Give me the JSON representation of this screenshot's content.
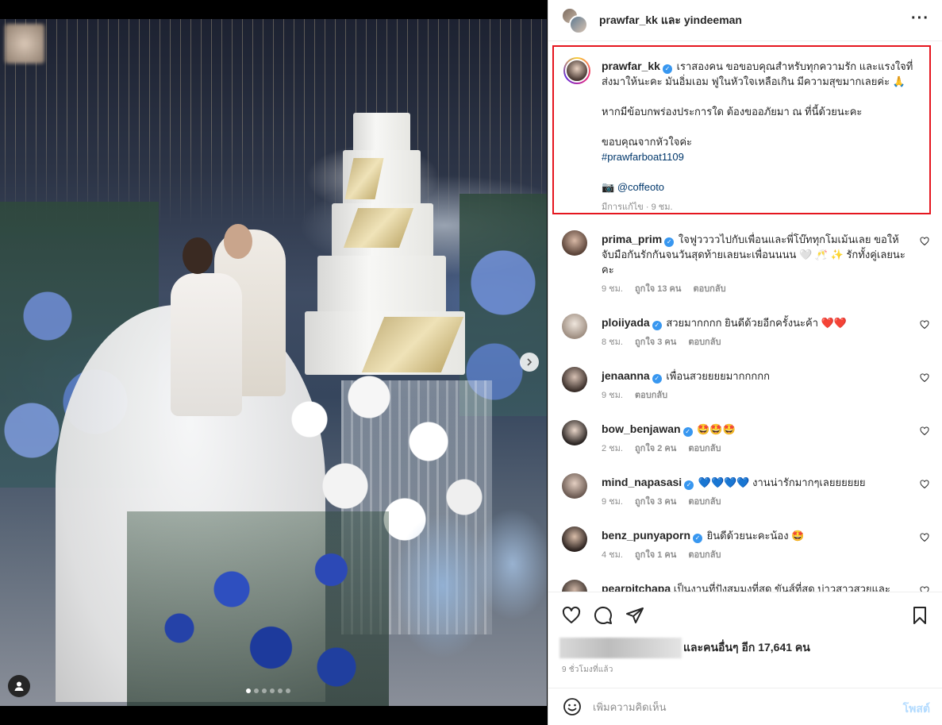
{
  "post": {
    "header": {
      "title_user1": "prawfar_kk",
      "title_and": "และ",
      "title_user2": "yindeeman"
    },
    "caption": {
      "username": "prawfar_kk",
      "line1": "เราสองคน ขอขอบคุณสำหรับทุกความรัก และแรงใจที่ส่งมาให้นะคะ มันอิ่มเอม ฟูในหัวใจเหลือเกิน มีความสุขมากเลยค่ะ 🙏",
      "line2": "หากมีข้อบกพร่องประการใด ต้องขออภัยมา ณ ที่นี้ด้วยนะคะ",
      "line3": "ขอบคุณจากหัวใจค่ะ",
      "hashtag": "#prawfarboat1109",
      "camera_emoji": "📷",
      "credit": "@coffeoto",
      "meta": "มีการแก้ไข · 9 ชม."
    },
    "comments": [
      {
        "username": "prima_prim",
        "text": "ใจฟูววววไปกับเพื่อนและพี่โบ๊ททุกโมเม้นเลย ขอให้จับมือกันรักกันจนวันสุดท้ายเลยนะเพื่อนนนน 🤍 🥂 ✨ รักทั้งคู่เลยนะคะ",
        "time": "9 ชม.",
        "likes": "ถูกใจ 13 คน",
        "reply": "ตอบกลับ"
      },
      {
        "username": "ploiiyada",
        "text": "สวยมากกกก ยินดีด้วยอีกครั้งนะค้า ❤️❤️",
        "time": "8 ชม.",
        "likes": "ถูกใจ 3 คน",
        "reply": "ตอบกลับ"
      },
      {
        "username": "jenaanna",
        "text": "เพื่อนสวยยยยมากกกกก",
        "time": "9 ชม.",
        "likes": "",
        "reply": "ตอบกลับ"
      },
      {
        "username": "bow_benjawan",
        "text": "🤩🤩🤩",
        "time": "2 ชม.",
        "likes": "ถูกใจ 2 คน",
        "reply": "ตอบกลับ"
      },
      {
        "username": "mind_napasasi",
        "text": "💙💙💙💙 งานน่ารักมากๆเลยยยยยย",
        "time": "9 ชม.",
        "likes": "ถูกใจ 3 คน",
        "reply": "ตอบกลับ"
      },
      {
        "username": "benz_punyaporn",
        "text": "ยินดีด้วยนะคะน้อง 🤩",
        "time": "4 ชม.",
        "likes": "ถูกใจ 1 คน",
        "reply": "ตอบกลับ"
      },
      {
        "username": "pearpitchapa",
        "text": "เป็นงานที่ปังสมมงที่สุด ขันส์ที่สุด บ่าวสาวสวยและ",
        "time": "",
        "likes": "",
        "reply": ""
      }
    ],
    "likes_text": "และคนอื่นๆ อีก 17,641 คน",
    "post_time": "9 ชั่วโมงที่แล้ว",
    "comment_placeholder": "เพิ่มความคิดเห็น",
    "post_button": "โพสต์",
    "carousel": {
      "slide_count": 6,
      "active_index": 0
    }
  },
  "icons": {
    "more": "more-horizontal-icon",
    "like": "heart-icon",
    "comment": "comment-icon",
    "share": "send-icon",
    "save": "bookmark-icon",
    "emoji": "emoji-icon",
    "next": "chevron-right-icon",
    "user_tag": "user-tag-icon",
    "verified": "verified-badge-icon"
  },
  "colors": {
    "highlight_border": "#e5161f",
    "verified": "#3897f0",
    "link": "#00376b",
    "muted": "#8e8e8e",
    "post_button_disabled": "#b3dbff"
  }
}
